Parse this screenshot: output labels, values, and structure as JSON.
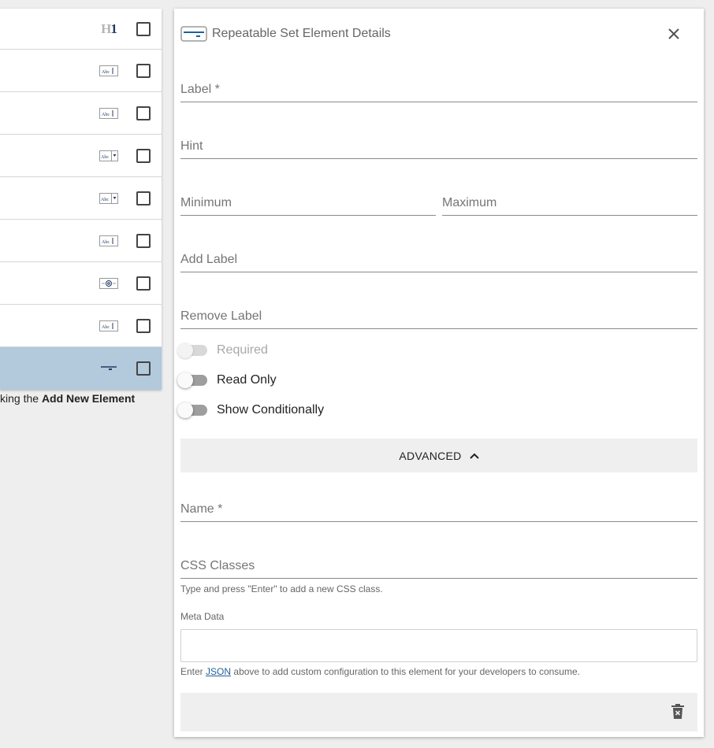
{
  "element_list": {
    "rows": [
      {
        "icon": "heading-h1-icon",
        "icon_text": "H1",
        "selected": false
      },
      {
        "icon": "text-field-icon",
        "icon_text": "Abc",
        "selected": false
      },
      {
        "icon": "text-field-icon",
        "icon_text": "Abc",
        "selected": false
      },
      {
        "icon": "dropdown-field-icon",
        "icon_text": "Abc",
        "selected": false
      },
      {
        "icon": "dropdown-field-icon",
        "icon_text": "Abc",
        "selected": false
      },
      {
        "icon": "text-field-icon",
        "icon_text": "Abc",
        "selected": false
      },
      {
        "icon": "email-field-icon",
        "icon_text": "@",
        "selected": false
      },
      {
        "icon": "text-field-icon",
        "icon_text": "Abc",
        "selected": false
      },
      {
        "icon": "repeatable-set-icon",
        "icon_text": "",
        "selected": true
      }
    ],
    "hint_prefix": "king the",
    "hint_bold": "Add New Element"
  },
  "panel": {
    "title": "Repeatable Set Element Details",
    "header_icon": "repeatable-set-icon",
    "fields": {
      "label": "Label *",
      "hint": "Hint",
      "minimum": "Minimum",
      "maximum": "Maximum",
      "add_label": "Add Label",
      "remove_label": "Remove Label",
      "name": "Name *",
      "css_classes": "CSS Classes"
    },
    "toggles": {
      "required": {
        "label": "Required",
        "disabled": true,
        "on": false
      },
      "read_only": {
        "label": "Read Only",
        "disabled": false,
        "on": false
      },
      "show_conditionally": {
        "label": "Show Conditionally",
        "disabled": false,
        "on": false
      }
    },
    "advanced_label": "ADVANCED",
    "css_hint": "Type and press \"Enter\" to add a new CSS class.",
    "meta_data_label": "Meta Data",
    "meta_hint_prefix": "Enter",
    "meta_hint_link": "JSON",
    "meta_hint_suffix": "above to add custom configuration to this element for your developers to consume."
  },
  "colors": {
    "selected_row": "#b3c9dc",
    "accent": "#1f5f9a",
    "background": "#eeeeee"
  }
}
